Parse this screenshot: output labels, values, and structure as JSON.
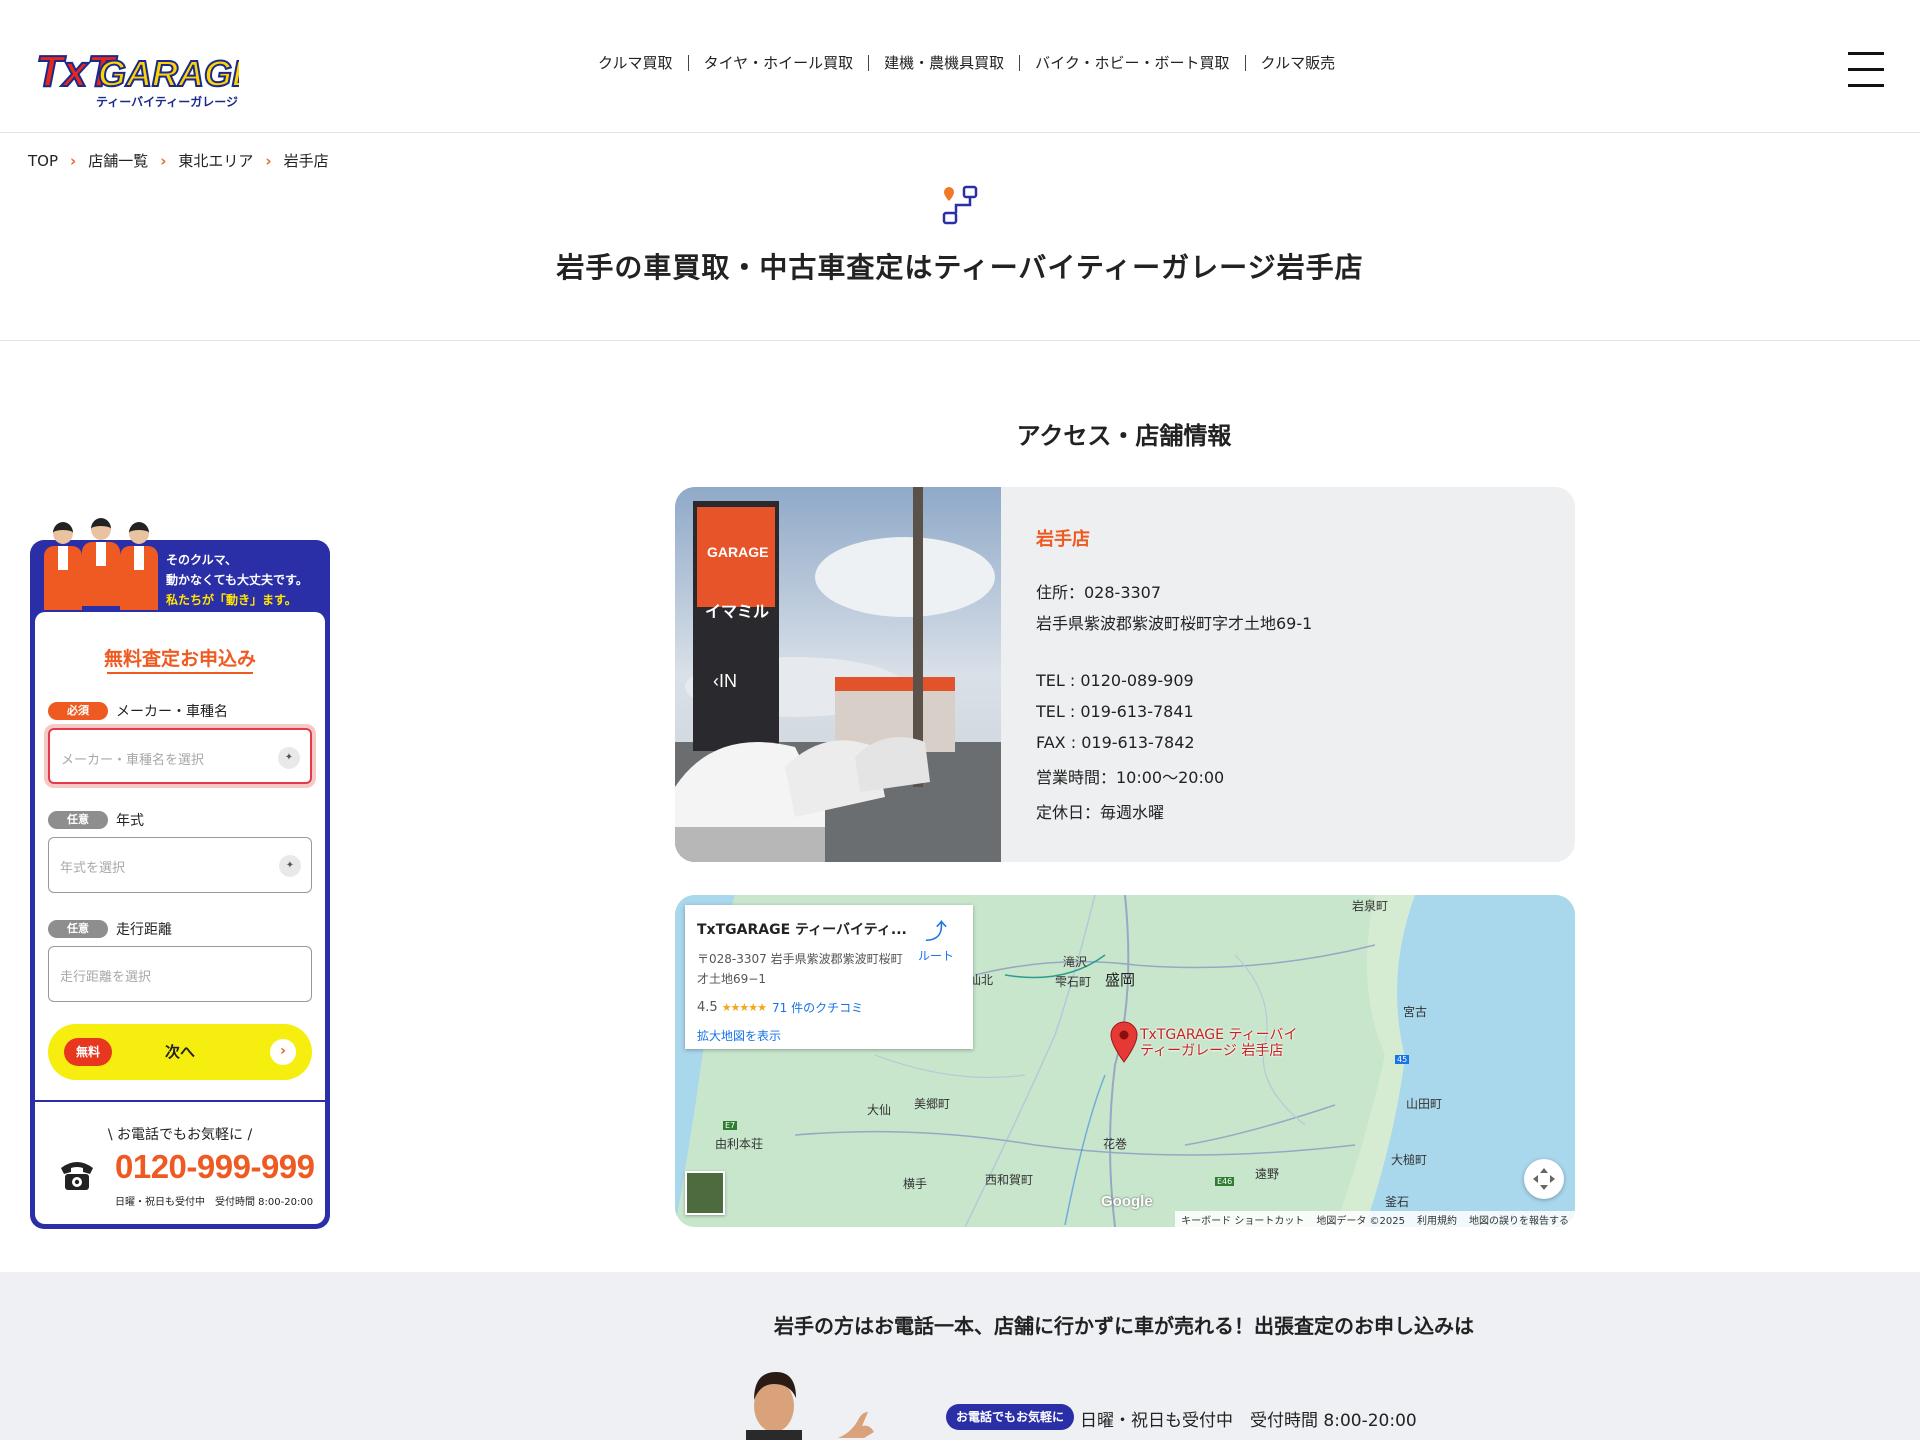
{
  "header": {
    "logo_text": "TxTGARAGE",
    "logo_sub": "ティーバイティーガレージ",
    "nav": [
      "クルマ買取",
      "タイヤ・ホイール買取",
      "建機・農機具買取",
      "バイク・ホビー・ボート買取",
      "クルマ販売"
    ]
  },
  "breadcrumb": [
    "TOP",
    "店舗一覧",
    "東北エリア",
    "岩手店"
  ],
  "page_title": "岩手の車買取・中古車査定はティーバイティーガレージ岩手店",
  "widget": {
    "banner_line1": "そのクルマ、",
    "banner_line2": "動かなくても大丈夫です。",
    "banner_line3": "私たちが「動き」ます。",
    "form_title": "無料査定お申込み",
    "fields": [
      {
        "tag": "必須",
        "label": "メーカー・車種名",
        "placeholder": "メーカー・車種名を選択"
      },
      {
        "tag": "任意",
        "label": "年式",
        "placeholder": "年式を選択"
      },
      {
        "tag": "任意",
        "label": "走行距離",
        "placeholder": "走行距離を選択"
      }
    ],
    "free_badge": "無料",
    "next_label": "次へ",
    "phone_caption": "\\ お電話でもお気軽に /",
    "phone_number": "0120-999-999",
    "phone_hours": "日曜・祝日も受付中　受付時間 8:00-20:00"
  },
  "access": {
    "section_title": "アクセス・店舗情報",
    "store_name": "岩手店",
    "postal": "住所：028-3307",
    "address": "岩手県紫波郡紫波町桜町字才土地69-1",
    "tel1": "TEL : 0120-089-909",
    "tel2": "TEL : 019-613-7841",
    "fax": "FAX : 019-613-7842",
    "hours": "営業時間：10:00〜20:00",
    "closed": "定休日：毎週水曜",
    "photo_sign_in": "‹IN",
    "photo_sign_brand": "イマミル"
  },
  "map": {
    "card_title": "TxTGARAGE ティーバイティ...",
    "card_address": "〒028-3307 岩手県紫波郡紫波町桜町才土地69−1",
    "route_label": "ルート",
    "rating": "4.5",
    "stars": "★★★★★",
    "reviews": "71 件のクチコミ",
    "enlarge": "拡大地図を表示",
    "pin_label_1": "TxTGARAGE ティーバイ",
    "pin_label_2": "ティーガレージ 岩手店",
    "places": {
      "iwaizumi": "岩泉町",
      "takizawa": "滝沢",
      "shizukuishi": "雫石町",
      "morioka": "盛岡",
      "senboku": "仙北",
      "miyako": "宮古",
      "yamada": "山田町",
      "daisen": "大仙",
      "misato": "美郷町",
      "hanamaki": "花巻",
      "yurihonjo": "由利本荘",
      "otsuchi": "大槌町",
      "yokote": "横手",
      "nishiwaga": "西和賀町",
      "tono": "遠野",
      "kamaishi": "釜石",
      "road_e7": "E7",
      "road_e46": "E46",
      "road_45": "45"
    },
    "google": "Google",
    "footer": [
      "キーボード ショートカット",
      "地図データ ©2025",
      "利用規約",
      "地図の誤りを報告する"
    ]
  },
  "band": {
    "title": "岩手の方はお電話一本、店舗に行かずに車が売れる！出張査定のお申し込みは",
    "pill": "お電話でもお気軽に",
    "hours": "日曜・祝日も受付中　受付時間 8:00-20:00"
  }
}
